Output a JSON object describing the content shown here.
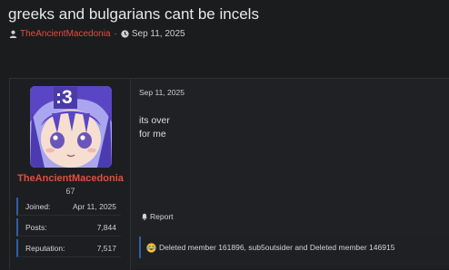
{
  "thread": {
    "title": "greeks and bulgarians cant be incels",
    "author": "TheAncientMacedonia",
    "separator": "·",
    "date": "Sep 11, 2025"
  },
  "post": {
    "date": "Sep 11, 2025",
    "body_lines": [
      "its over",
      "for me"
    ],
    "report_label": "Report",
    "reactions_text": "Deleted member 161896, sub5outsider and Deleted member 146915"
  },
  "user": {
    "name": "TheAncientMacedonia",
    "level": "67",
    "avatar_text": ":3",
    "stats": [
      {
        "label": "Joined:",
        "value": "Apr 11, 2025"
      },
      {
        "label": "Posts:",
        "value": "7,844"
      },
      {
        "label": "Reputation:",
        "value": "7,517"
      }
    ]
  },
  "icons": {
    "user": "user-icon",
    "clock": "clock-icon",
    "report": "bell-icon",
    "reaction": "crying-laughing-emoji-icon"
  },
  "colors": {
    "background": "#1b1c1e",
    "author_red": "#e04f3e",
    "accent_blue": "#2f5fa8"
  }
}
